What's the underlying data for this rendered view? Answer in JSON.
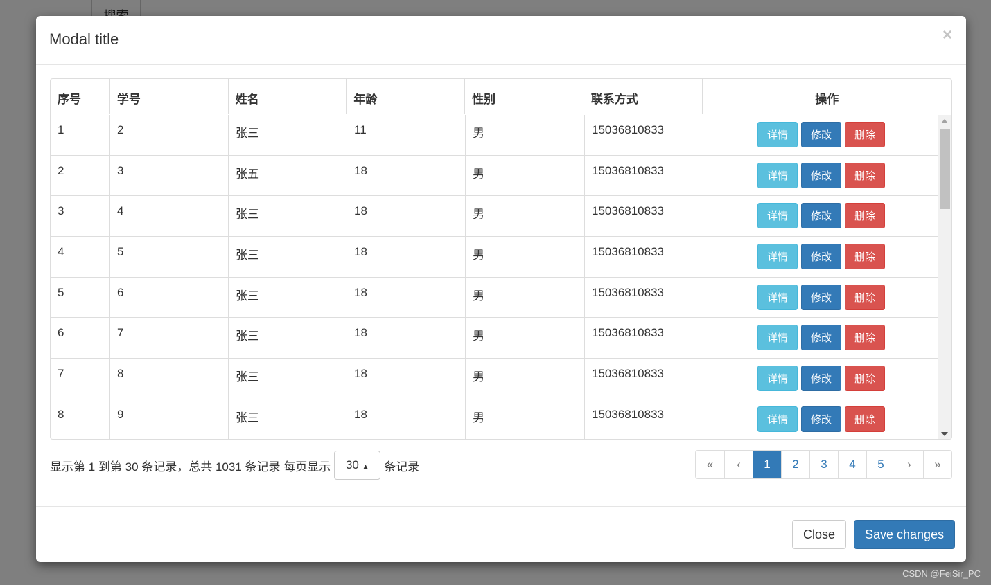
{
  "background": {
    "search_button": "搜索"
  },
  "modal": {
    "title": "Modal title",
    "close_symbol": "×"
  },
  "table": {
    "headers": [
      "序号",
      "学号",
      "姓名",
      "年龄",
      "性别",
      "联系方式",
      "操作"
    ],
    "rows": [
      [
        "1",
        "2",
        "张三",
        "11",
        "男",
        "15036810833"
      ],
      [
        "2",
        "3",
        "张五",
        "18",
        "男",
        "15036810833"
      ],
      [
        "3",
        "4",
        "张三",
        "18",
        "男",
        "15036810833"
      ],
      [
        "4",
        "5",
        "张三",
        "18",
        "男",
        "15036810833"
      ],
      [
        "5",
        "6",
        "张三",
        "18",
        "男",
        "15036810833"
      ],
      [
        "6",
        "7",
        "张三",
        "18",
        "男",
        "15036810833"
      ],
      [
        "7",
        "8",
        "张三",
        "18",
        "男",
        "15036810833"
      ],
      [
        "8",
        "9",
        "张三",
        "18",
        "男",
        "15036810833"
      ]
    ],
    "actions": {
      "detail": "详情",
      "edit": "修改",
      "delete": "删除"
    }
  },
  "footer": {
    "summary": "显示第 1 到第 30 条记录，总共 1031 条记录 每页显示",
    "page_size": "30",
    "suffix": "条记录"
  },
  "pagination": {
    "items": [
      "«",
      "‹",
      "1",
      "2",
      "3",
      "4",
      "5",
      "›",
      "»"
    ],
    "active": "1"
  },
  "buttons": {
    "close": "Close",
    "save": "Save changes"
  },
  "watermark": "CSDN @FeiSir_PC",
  "colors": {
    "info": "#5bc0de",
    "primary": "#337ab7",
    "danger": "#d9534f"
  }
}
